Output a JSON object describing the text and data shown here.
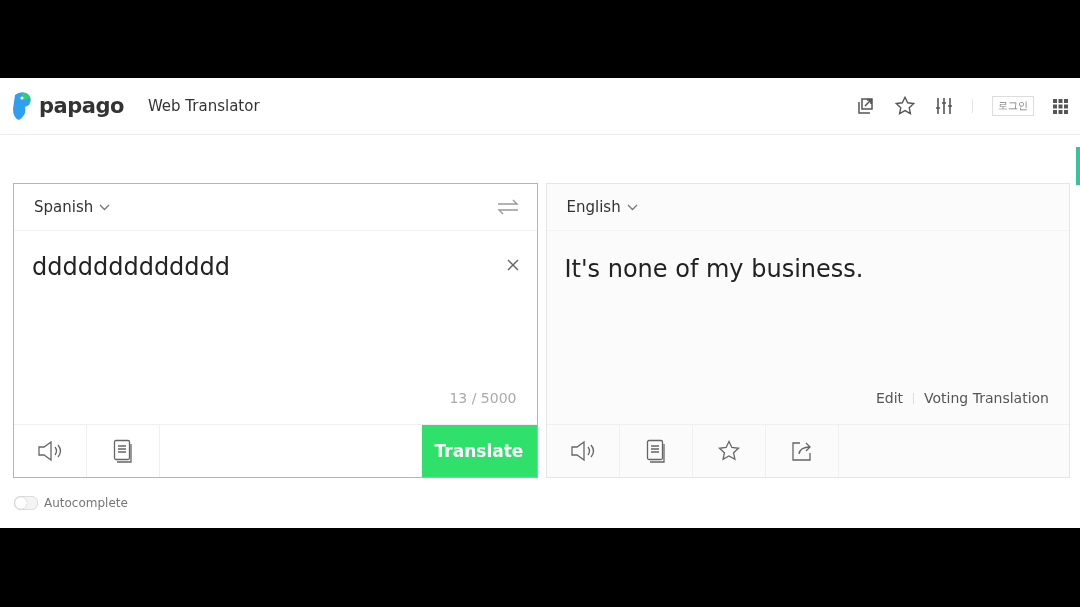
{
  "header": {
    "logo": "papago",
    "subtitle": "Web Translator",
    "login_button": "로그인"
  },
  "source": {
    "language": "Spanish",
    "value": "ddddddddddddd",
    "counter": "13 / 5000",
    "translate_button": "Translate"
  },
  "target": {
    "language": "English",
    "text": "It's none of my business.",
    "links": [
      "Edit",
      "Voting Translation"
    ]
  },
  "autocomplete": {
    "label": "Autocomplete",
    "on": false
  }
}
